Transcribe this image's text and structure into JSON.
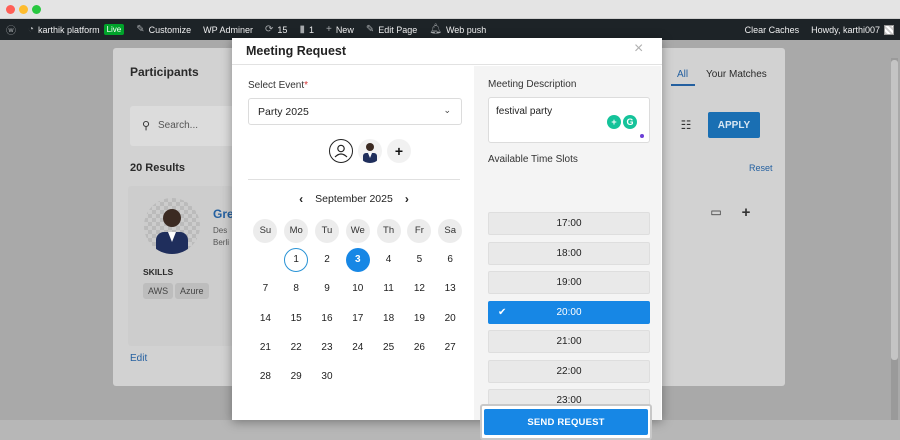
{
  "window": {
    "traffic_colors": [
      "#ff5f57",
      "#febc2e",
      "#28c840"
    ]
  },
  "adminbar": {
    "site_name": "karthik platform",
    "live_badge": "Live",
    "customize": "Customize",
    "wp_adminer": "WP Adminer",
    "updates_count": "15",
    "comments_count": "1",
    "new_label": "New",
    "edit_page": "Edit Page",
    "web_push": "Web push",
    "clear_caches": "Clear Caches",
    "howdy": "Howdy, karthi007"
  },
  "background": {
    "participants_title": "Participants",
    "tab_all": "All",
    "tab_your_matches": "Your Matches",
    "search_placeholder": "Search...",
    "apply": "APPLY",
    "results": "20 Results",
    "reset": "Reset",
    "profile_name": "Gre",
    "profile_line1": "Des",
    "profile_line2": "Berli",
    "skills_label": "SKILLS",
    "skills": [
      "AWS",
      "Azure"
    ],
    "edit": "Edit"
  },
  "modal": {
    "title": "Meeting Request",
    "close": "×",
    "select_event_label": "Select Event",
    "required_mark": "*",
    "selected_event": "Party 2025",
    "calendar": {
      "month_label": "September 2025",
      "prev": "‹",
      "next": "›",
      "weekdays": [
        "Su",
        "Mo",
        "Tu",
        "We",
        "Th",
        "Fr",
        "Sa"
      ],
      "first_weekday_index": 1,
      "days": [
        "1",
        "2",
        "3",
        "4",
        "5",
        "6",
        "7",
        "8",
        "9",
        "10",
        "11",
        "12",
        "13",
        "14",
        "15",
        "16",
        "17",
        "18",
        "19",
        "20",
        "21",
        "22",
        "23",
        "24",
        "25",
        "26",
        "27",
        "28",
        "29",
        "30"
      ],
      "today": "1",
      "selected": "3"
    },
    "description_label": "Meeting Description",
    "description_value": "festival party",
    "time_slots_label": "Available Time Slots",
    "time_slots": [
      "17:00",
      "18:00",
      "19:00",
      "20:00",
      "21:00",
      "22:00",
      "23:00"
    ],
    "selected_slot": "20:00",
    "send_button": "SEND REQUEST",
    "accent_color": "#1787e5"
  }
}
